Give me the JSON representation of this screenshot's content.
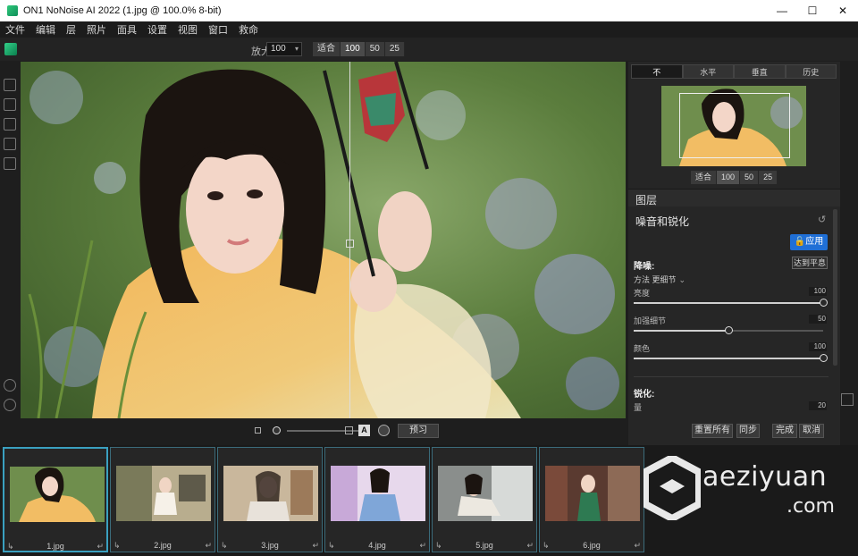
{
  "window": {
    "title": "ON1 NoNoise AI 2022 (1.jpg @ 100.0% 8-bit)",
    "controls": {
      "minimize": "—",
      "maximize": "☐",
      "close": "✕"
    }
  },
  "menu": [
    "文件",
    "编辑",
    "层",
    "照片",
    "面具",
    "设置",
    "视图",
    "窗口",
    "救命"
  ],
  "toolbar": {
    "zoom_label": "放大",
    "zoom_value": "100",
    "view_buttons": [
      "适合",
      "100",
      "50",
      "25"
    ]
  },
  "preview_panel": {
    "tabs": [
      "不",
      "水平",
      "垂直",
      "历史"
    ],
    "view_buttons": [
      "适合",
      "100",
      "50",
      "25"
    ]
  },
  "layers": {
    "title": "图层",
    "section_title": "噪音和锐化",
    "apply_label": "应用",
    "noise_title": "降噪:",
    "ai_button": "达到平息",
    "method_label": "方法",
    "method_value": "更细节",
    "params": [
      {
        "label": "亮度",
        "value": "100",
        "level": 1.0
      },
      {
        "label": "加强细节",
        "value": "50",
        "level": 0.5
      },
      {
        "label": "颜色",
        "value": "100",
        "level": 1.0
      }
    ],
    "sharpen_title": "锐化:",
    "sharpen_amount_label": "量",
    "sharpen_amount_value": "20"
  },
  "canvas_toolbar": {
    "preview_label": "预习",
    "compare_label": "A"
  },
  "actions": {
    "reset_all": "重置所有",
    "sync": "同步",
    "done": "完成",
    "cancel": "取消"
  },
  "filmstrip": [
    {
      "name": "1.jpg",
      "selected": true
    },
    {
      "name": "2.jpg",
      "selected": false
    },
    {
      "name": "3.jpg",
      "selected": false
    },
    {
      "name": "4.jpg",
      "selected": false
    },
    {
      "name": "5.jpg",
      "selected": false
    },
    {
      "name": "6.jpg",
      "selected": false
    }
  ],
  "watermark": {
    "name": "aeziyuan",
    "tld": ".com"
  }
}
